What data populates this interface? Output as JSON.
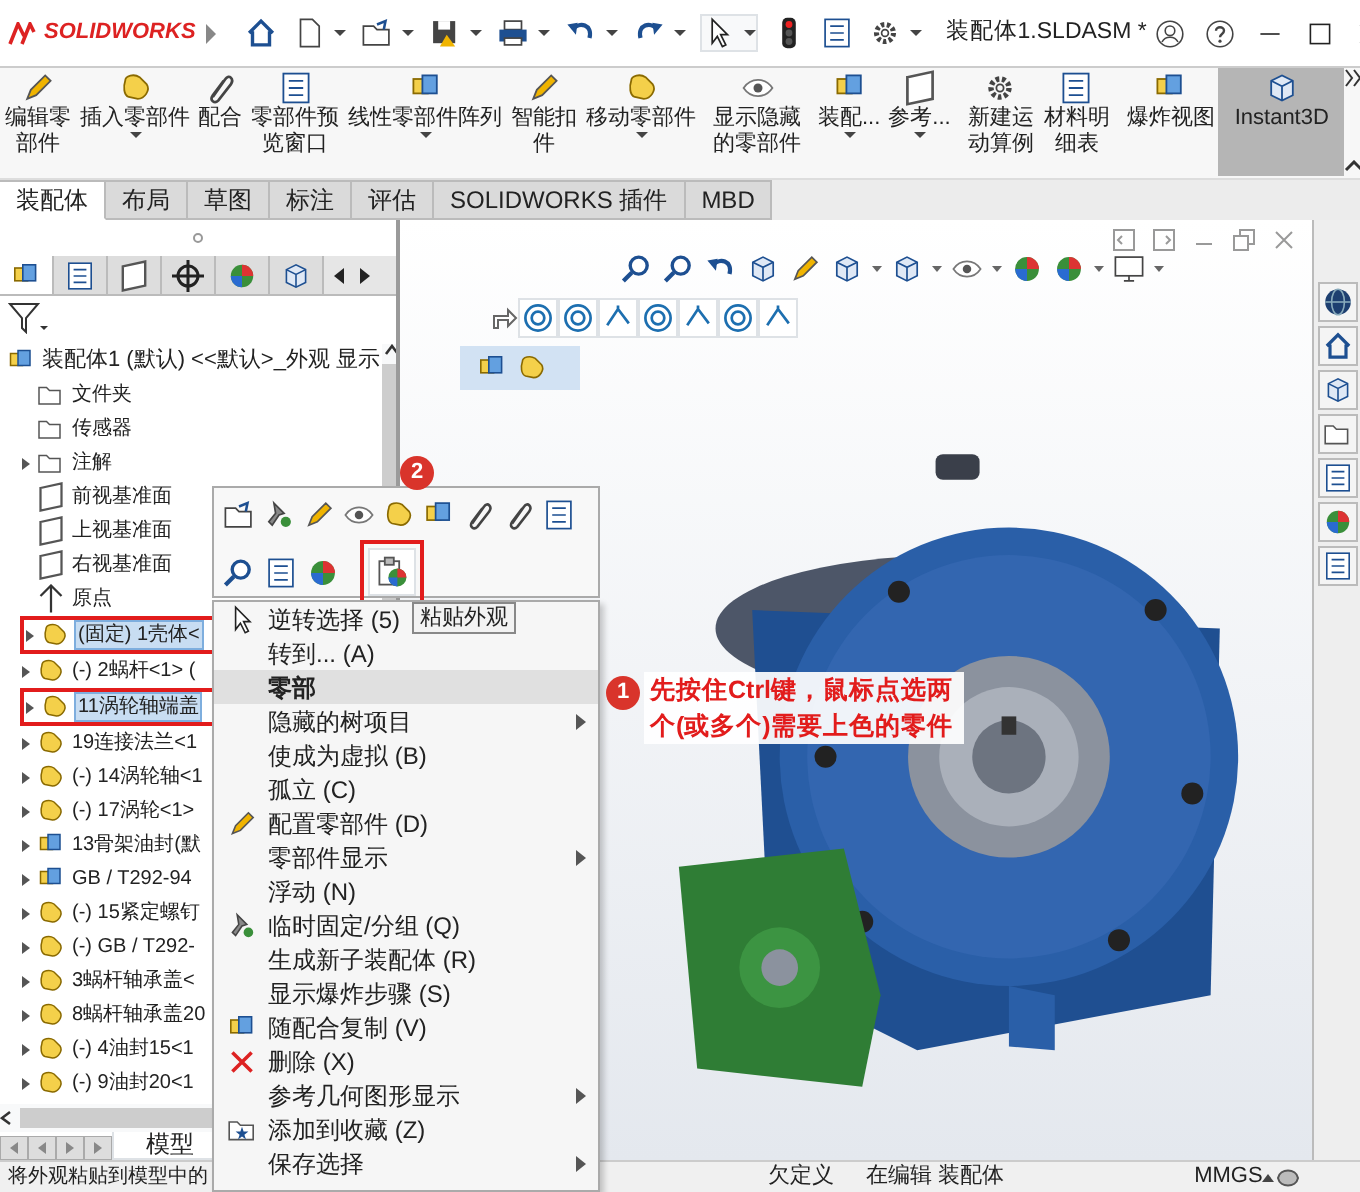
{
  "title_bar": {
    "brand": "SOLIDWORKS",
    "document_title": "装配体1.SLDASM *"
  },
  "command_buttons": [
    {
      "label": "编辑零部件",
      "dropdown": false,
      "selected": false
    },
    {
      "label": "插入零部件",
      "dropdown": true,
      "selected": false
    },
    {
      "label": "配合",
      "dropdown": false,
      "selected": false
    },
    {
      "label": "零部件预览窗口",
      "dropdown": false,
      "selected": false
    },
    {
      "label": "线性零部件阵列",
      "dropdown": true,
      "selected": false
    },
    {
      "label": "智能扣件",
      "dropdown": false,
      "selected": false
    },
    {
      "label": "移动零部件",
      "dropdown": true,
      "selected": false
    },
    {
      "label": "显示隐藏的零部件",
      "dropdown": false,
      "selected": false
    },
    {
      "label": "装配...",
      "dropdown": true,
      "selected": false
    },
    {
      "label": "参考...",
      "dropdown": true,
      "selected": false
    },
    {
      "label": "新建运动算例",
      "dropdown": false,
      "selected": false
    },
    {
      "label": "材料明细表",
      "dropdown": false,
      "selected": false
    },
    {
      "label": "爆炸视图",
      "dropdown": false,
      "selected": false
    },
    {
      "label": "Instant3D",
      "dropdown": false,
      "selected": true
    }
  ],
  "tabs": [
    {
      "label": "装配体",
      "selected": true
    },
    {
      "label": "布局",
      "selected": false
    },
    {
      "label": "草图",
      "selected": false
    },
    {
      "label": "标注",
      "selected": false
    },
    {
      "label": "评估",
      "selected": false
    },
    {
      "label": "SOLIDWORKS 插件",
      "selected": false
    },
    {
      "label": "MBD",
      "selected": false
    }
  ],
  "tree": [
    {
      "label": "装配体1 (默认) <<默认>_外观 显示",
      "kind": "root",
      "selected": false
    },
    {
      "label": "文件夹",
      "kind": "folder",
      "selected": false
    },
    {
      "label": "传感器",
      "kind": "sensor",
      "selected": false
    },
    {
      "label": "注解",
      "kind": "annotation",
      "selected": false
    },
    {
      "label": "前视基准面",
      "kind": "plane",
      "selected": false
    },
    {
      "label": "上视基准面",
      "kind": "plane",
      "selected": false
    },
    {
      "label": "右视基准面",
      "kind": "plane",
      "selected": false
    },
    {
      "label": "原点",
      "kind": "origin",
      "selected": false
    },
    {
      "label": "(固定) 1壳体<",
      "kind": "part",
      "selected": true
    },
    {
      "label": "(-) 2蜗杆<1> (",
      "kind": "part",
      "selected": false
    },
    {
      "label": "11涡轮轴端盖",
      "kind": "part",
      "selected": true
    },
    {
      "label": "19连接法兰<1",
      "kind": "part",
      "selected": false
    },
    {
      "label": "(-) 14涡轮轴<1",
      "kind": "part",
      "selected": false
    },
    {
      "label": "(-) 17涡轮<1>",
      "kind": "part",
      "selected": false
    },
    {
      "label": "13骨架油封(默",
      "kind": "subassembly",
      "selected": false
    },
    {
      "label": "GB / T292-94",
      "kind": "subassembly",
      "selected": false
    },
    {
      "label": "(-) 15紧定螺钉",
      "kind": "part",
      "selected": false
    },
    {
      "label": "(-) GB / T292-",
      "kind": "part",
      "selected": false
    },
    {
      "label": "3蜗杆轴承盖<",
      "kind": "part",
      "selected": false
    },
    {
      "label": "8蜗杆轴承盖20",
      "kind": "part",
      "selected": false
    },
    {
      "label": "(-) 4油封15<1",
      "kind": "part",
      "selected": false
    },
    {
      "label": "(-) 9油封20<1",
      "kind": "part",
      "selected": false
    }
  ],
  "bottom_tabs": [
    {
      "label": "模型",
      "selected": true
    }
  ],
  "tooltip": "粘贴外观",
  "context_menu": [
    {
      "label": "逆转选择 (5)",
      "kind": "item",
      "submenu": false
    },
    {
      "label": "转到... (A)",
      "kind": "item",
      "submenu": false
    },
    {
      "label": "零部",
      "kind": "header",
      "submenu": false
    },
    {
      "label": "隐藏的树项目",
      "kind": "item",
      "submenu": true
    },
    {
      "label": "使成为虚拟 (B)",
      "kind": "item",
      "submenu": false
    },
    {
      "label": "孤立 (C)",
      "kind": "item",
      "submenu": false
    },
    {
      "label": "配置零部件 (D)",
      "kind": "item",
      "submenu": false
    },
    {
      "label": "零部件显示",
      "kind": "item",
      "submenu": true
    },
    {
      "label": "浮动 (N)",
      "kind": "item",
      "submenu": false
    },
    {
      "label": "临时固定/分组 (Q)",
      "kind": "item",
      "submenu": false
    },
    {
      "label": "生成新子装配体 (R)",
      "kind": "item",
      "submenu": false
    },
    {
      "label": "显示爆炸步骤 (S)",
      "kind": "item",
      "submenu": false
    },
    {
      "label": "随配合复制 (V)",
      "kind": "item",
      "submenu": false
    },
    {
      "label": "删除 (X)",
      "kind": "item",
      "submenu": false
    },
    {
      "label": "参考几何图形显示",
      "kind": "item",
      "submenu": true
    },
    {
      "label": "添加到收藏 (Z)",
      "kind": "item",
      "submenu": false
    },
    {
      "label": "保存选择",
      "kind": "item",
      "submenu": true
    }
  ],
  "callouts": [
    {
      "number": "1",
      "text": "先按住Ctrl键，鼠标点选两个(或多个)需要上色的零件"
    },
    {
      "number": "2"
    }
  ],
  "status_bar": {
    "hint": "将外观粘贴到模型中的",
    "state": "欠定义",
    "mode": "在编辑 装配体",
    "units": "MMGS"
  }
}
